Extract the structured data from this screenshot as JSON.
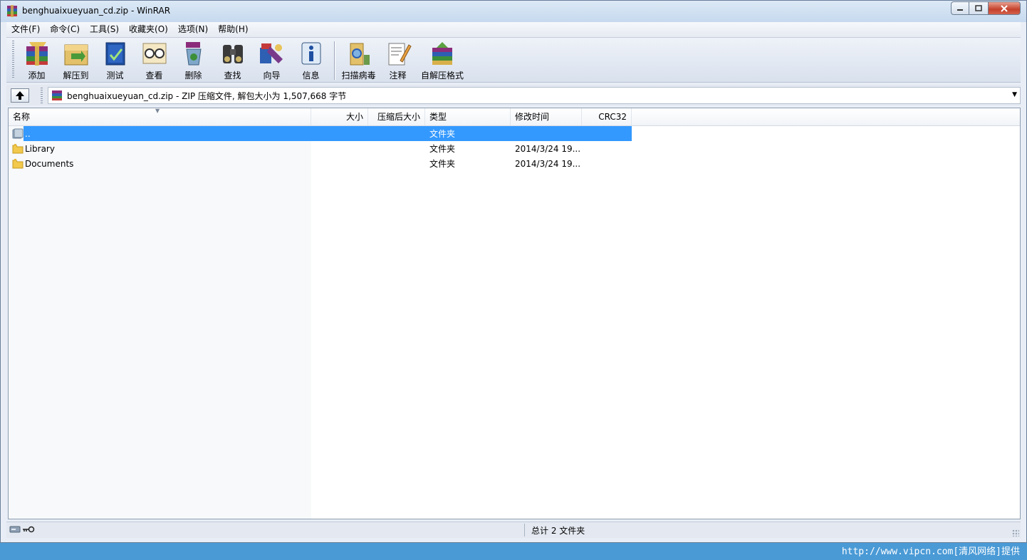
{
  "window": {
    "title": "benghuaixueyuan_cd.zip - WinRAR"
  },
  "menu": [
    {
      "label": "文件(F)"
    },
    {
      "label": "命令(C)"
    },
    {
      "label": "工具(S)"
    },
    {
      "label": "收藏夹(O)"
    },
    {
      "label": "选项(N)"
    },
    {
      "label": "帮助(H)"
    }
  ],
  "toolbar": {
    "buttons": [
      {
        "label": "添加",
        "icon": "add-archive-icon"
      },
      {
        "label": "解压到",
        "icon": "extract-to-icon"
      },
      {
        "label": "测试",
        "icon": "test-icon"
      },
      {
        "label": "查看",
        "icon": "view-icon"
      },
      {
        "label": "删除",
        "icon": "delete-icon"
      },
      {
        "label": "查找",
        "icon": "find-icon"
      },
      {
        "label": "向导",
        "icon": "wizard-icon"
      },
      {
        "label": "信息",
        "icon": "info-icon"
      }
    ],
    "buttons2": [
      {
        "label": "扫描病毒",
        "icon": "virus-scan-icon"
      },
      {
        "label": "注释",
        "icon": "comment-icon"
      },
      {
        "label": "自解压格式",
        "icon": "sfx-icon"
      }
    ]
  },
  "address": {
    "text": "benghuaixueyuan_cd.zip - ZIP 压缩文件, 解包大小为 1,507,668 字节"
  },
  "columns": {
    "name": "名称",
    "size": "大小",
    "packed": "压缩后大小",
    "type": "类型",
    "modified": "修改时间",
    "crc": "CRC32"
  },
  "files": [
    {
      "name": "..",
      "size": "",
      "packed": "",
      "type": "文件夹",
      "modified": "",
      "crc": "",
      "selected": true
    },
    {
      "name": "Library",
      "size": "",
      "packed": "",
      "type": "文件夹",
      "modified": "2014/3/24 19...",
      "crc": ""
    },
    {
      "name": "Documents",
      "size": "",
      "packed": "",
      "type": "文件夹",
      "modified": "2014/3/24 19...",
      "crc": ""
    }
  ],
  "status": {
    "summary": "总计 2 文件夹"
  },
  "watermark": "http://www.vipcn.com[清风网络]提供",
  "colors": {
    "selection": "#3399ff",
    "folder": "#f2c94c"
  }
}
